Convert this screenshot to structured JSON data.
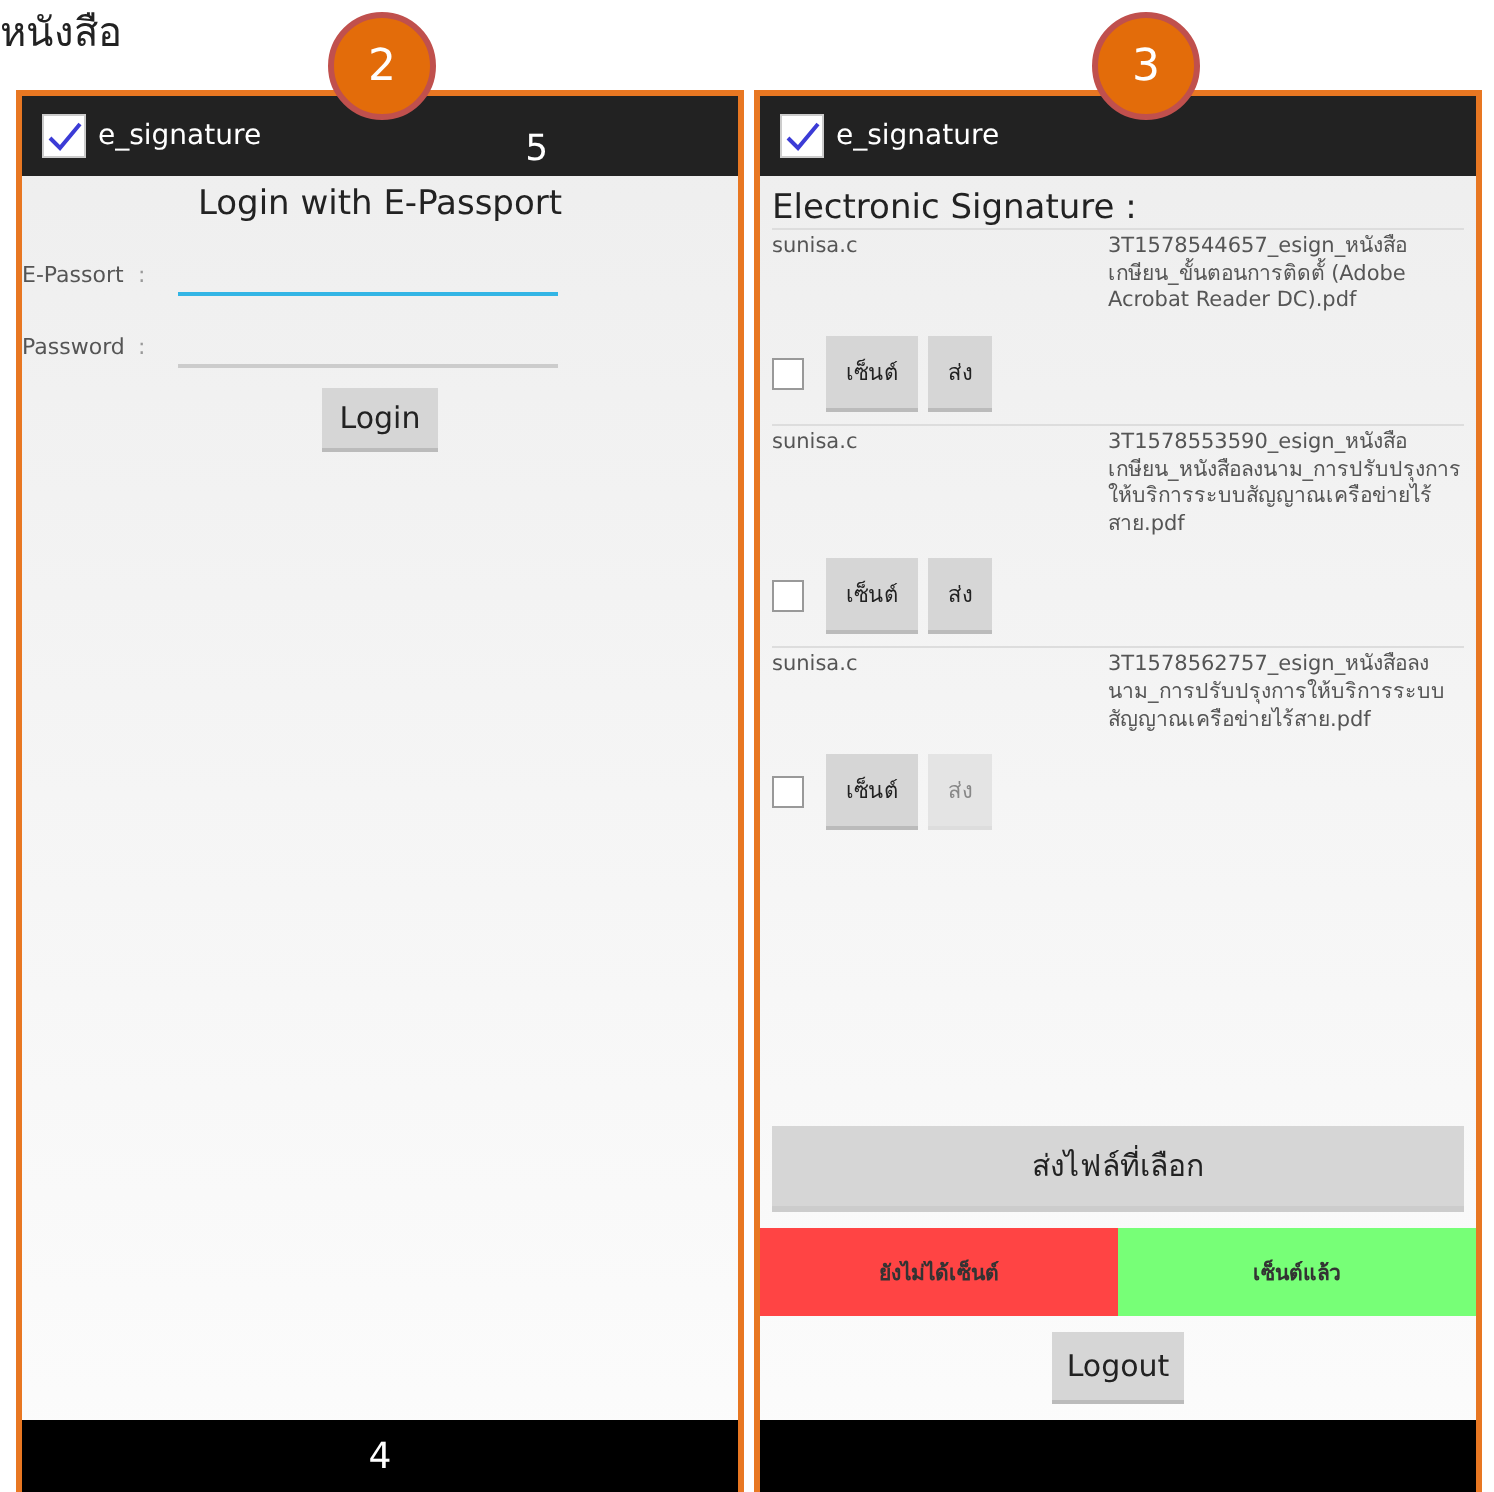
{
  "caption": "หนังสือ",
  "screens": [
    {
      "kind": "login",
      "badge": "2",
      "app_title": "e_signature",
      "title_annotation": "5",
      "heading": "Login with E-Passport",
      "fields": [
        {
          "label": "E-Passort",
          "separator": ":",
          "focused": true
        },
        {
          "label": "Password",
          "separator": ":",
          "focused": false
        }
      ],
      "button": "Login",
      "nav_annotation": "4"
    },
    {
      "kind": "list",
      "badge": "3",
      "app_title": "e_signature",
      "heading": "Electronic Signature :",
      "items": [
        {
          "user": "sunisa.c",
          "file": "3T1578544657_esign_หนังสือเกษียน_ขั้นตอนการติดตั้ (Adobe Acrobat Reader DC).pdf",
          "checked": false,
          "sign_label": "เซ็นต์",
          "send_label": "ส่ง",
          "send_disabled": false
        },
        {
          "user": "sunisa.c",
          "file": "3T1578553590_esign_หนังสือเกษียน_หนังสือลงนาม_การปรับปรุงการให้บริการระบบสัญญาณเครือข่ายไร้สาย.pdf",
          "checked": false,
          "sign_label": "เซ็นต์",
          "send_label": "ส่ง",
          "send_disabled": false
        },
        {
          "user": "sunisa.c",
          "file": "3T1578562757_esign_หนังสือลงนาม_การปรับปรุงการให้บริการระบบสัญญาณเครือข่ายไร้สาย.pdf",
          "checked": false,
          "sign_label": "เซ็นต์",
          "send_label": "ส่ง",
          "send_disabled": true
        }
      ],
      "send_selected": "ส่งไฟล์ที่เลือก",
      "legend": [
        {
          "label": "ยังไม่ได้เซ็นต์",
          "color": "#ff4444"
        },
        {
          "label": "เซ็นต์แล้ว",
          "color": "#77ff77"
        }
      ],
      "logout": "Logout"
    }
  ]
}
